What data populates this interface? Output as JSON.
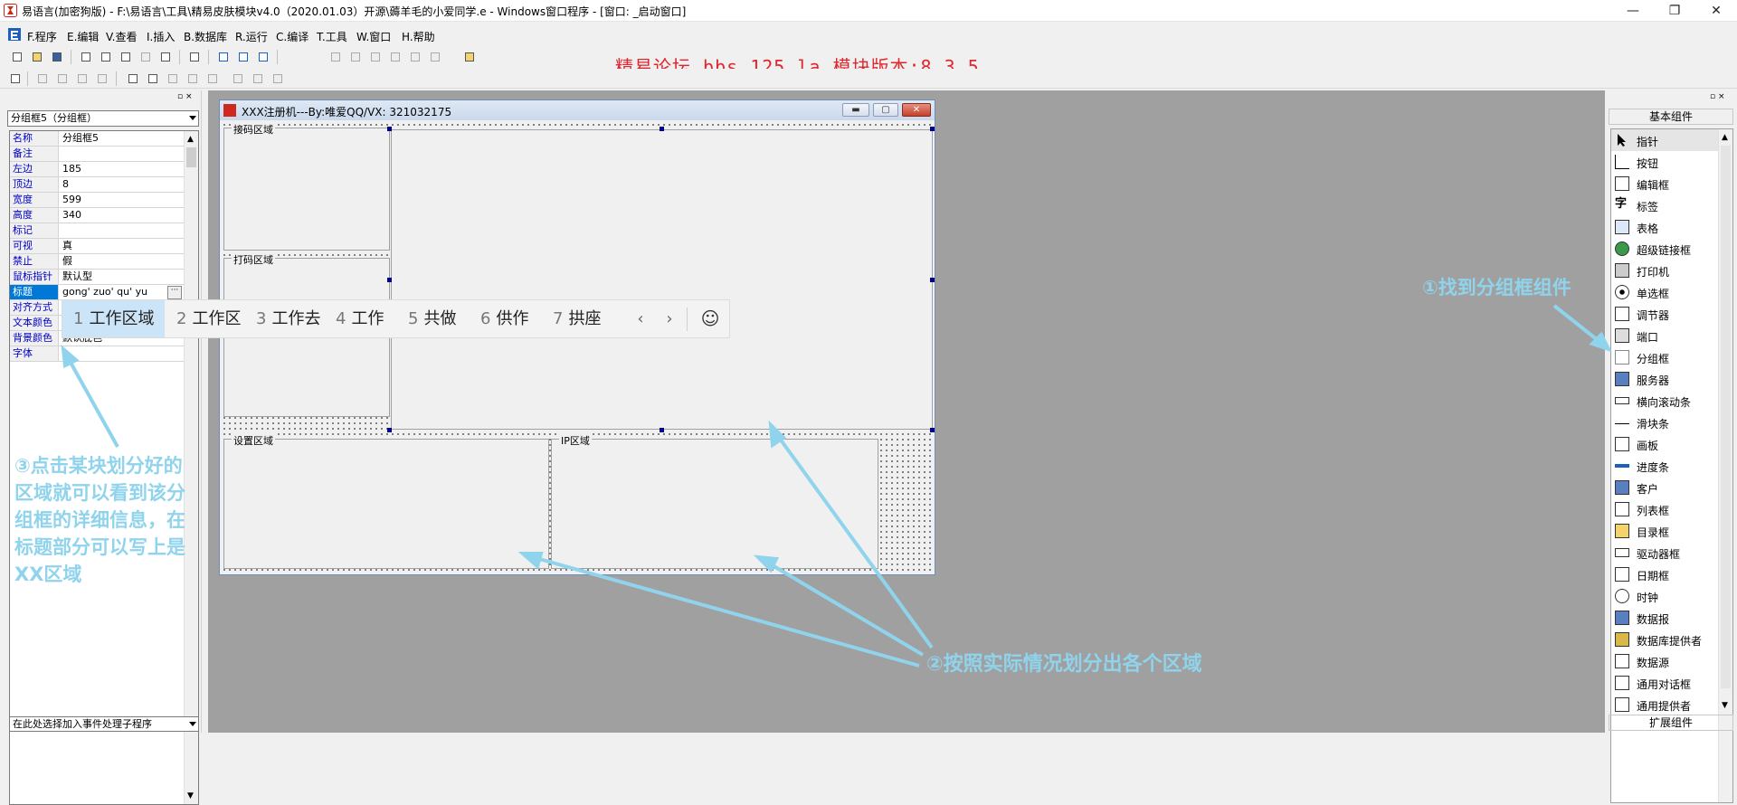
{
  "window": {
    "title": "易语言(加密狗版) - F:\\易语言\\工具\\精易皮肤模块v4.0（2020.01.03）开源\\薅羊毛的小爱同学.e - Windows窗口程序 - [窗口: _启动窗口]",
    "minimize": "—",
    "restore": "❐",
    "close": "✕"
  },
  "menu": [
    {
      "key": "F",
      "label": "F.程序"
    },
    {
      "key": "E",
      "label": "E.编辑"
    },
    {
      "key": "V",
      "label": "V.查看"
    },
    {
      "key": "I",
      "label": "I.插入"
    },
    {
      "key": "B",
      "label": "B.数据库"
    },
    {
      "key": "R",
      "label": "R.运行"
    },
    {
      "key": "C",
      "label": "C.编译"
    },
    {
      "key": "T",
      "label": "T.工具"
    },
    {
      "key": "W",
      "label": "W.窗口"
    },
    {
      "key": "H",
      "label": "H.帮助"
    }
  ],
  "banner": "精易论坛 bbs.125.la 模块版本:8.3.5",
  "properties": {
    "selected_object": "分组框5（分组框）",
    "rows": [
      {
        "name": "名称",
        "value": "分组框5"
      },
      {
        "name": "备注",
        "value": ""
      },
      {
        "name": "左边",
        "value": "185"
      },
      {
        "name": "顶边",
        "value": "8"
      },
      {
        "name": "宽度",
        "value": "599"
      },
      {
        "name": "高度",
        "value": "340"
      },
      {
        "name": "标记",
        "value": ""
      },
      {
        "name": "可视",
        "value": "真"
      },
      {
        "name": "禁止",
        "value": "假"
      },
      {
        "name": "鼠标指针",
        "value": "默认型"
      },
      {
        "name": "标题",
        "value": "gong' zuo' qu' yu"
      },
      {
        "name": "对齐方式",
        "value": ""
      },
      {
        "name": "文本颜色",
        "value": ""
      },
      {
        "name": "背景颜色",
        "value": "默认底色"
      },
      {
        "name": "字体",
        "value": ""
      }
    ],
    "event_placeholder": "在此处选择加入事件处理子程序"
  },
  "form": {
    "title": "XXX注册机---By:唯爱QQ/VX:  321032175",
    "groups": [
      {
        "id": "jiema",
        "label": "接码区域"
      },
      {
        "id": "dama",
        "label": "打码区域"
      },
      {
        "id": "work",
        "label": ""
      },
      {
        "id": "shezhi",
        "label": "设置区域"
      },
      {
        "id": "ip",
        "label": "IP区域"
      }
    ]
  },
  "ime": {
    "candidates": [
      {
        "num": "1",
        "text": "工作区域"
      },
      {
        "num": "2",
        "text": "工作区"
      },
      {
        "num": "3",
        "text": "工作去"
      },
      {
        "num": "4",
        "text": "工作"
      },
      {
        "num": "5",
        "text": "共做"
      },
      {
        "num": "6",
        "text": "供作"
      },
      {
        "num": "7",
        "text": "拱座"
      }
    ],
    "prev": "‹",
    "next": "›",
    "emoji": "☺"
  },
  "components": {
    "header": "基本组件",
    "items": [
      "指针",
      "按钮",
      "编辑框",
      "标签",
      "表格",
      "超级链接框",
      "打印机",
      "单选框",
      "调节器",
      "端口",
      "分组框",
      "服务器",
      "横向滚动条",
      "滑块条",
      "画板",
      "进度条",
      "客户",
      "列表框",
      "目录框",
      "驱动器框",
      "日期框",
      "时钟",
      "数据报",
      "数据库提供者",
      "数据源",
      "通用对话框",
      "通用提供者"
    ],
    "footer": "扩展组件"
  },
  "annotations": {
    "step1": "①找到分组框组件",
    "step2": "②按照实际情况划分出各个区域",
    "step3": "③点击某块划分好的区域就可以看到该分组框的详细信息，在标题部分可以写上是XX区域"
  },
  "colors": {
    "banner": "#e0252c",
    "annotation": "#8fd4ec",
    "design_bg": "#a0a0a0",
    "ime_selected": "#cce4f7"
  }
}
